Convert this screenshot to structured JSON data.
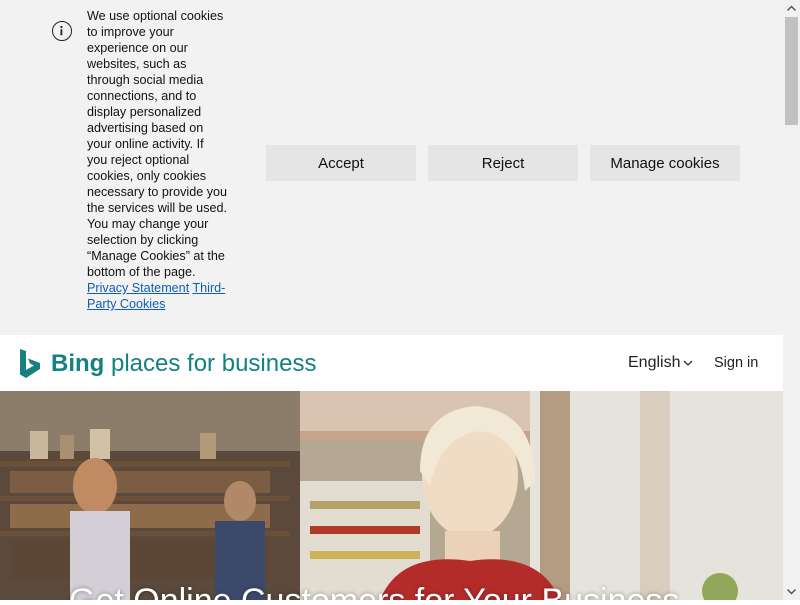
{
  "cookie_banner": {
    "text_before_links": "We use optional cookies to improve your experience on our websites, such as through social media connections, and to display personalized advertising based on your online activity. If you reject optional cookies, only cookies necessary to provide you the services will be used. You may change your selection by clicking “Manage Cookies” at the bottom of the page.",
    "privacy_link": "Privacy Statement",
    "third_party_link": "Third-Party Cookies",
    "accept_label": "Accept",
    "reject_label": "Reject",
    "manage_label": "Manage cookies",
    "icon": "info-icon"
  },
  "header": {
    "brand_bold": "Bing",
    "brand_rest": " places for business",
    "language": "English",
    "sign_in": "Sign in",
    "brand_color": "#158180"
  },
  "hero": {
    "title": "Get Online Customers for Your Business"
  }
}
